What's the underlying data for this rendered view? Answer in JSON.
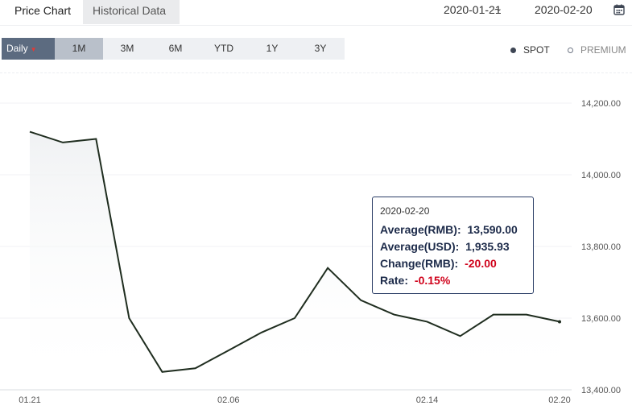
{
  "tabs": [
    {
      "label": "Price Chart"
    },
    {
      "label": "Historical Data"
    }
  ],
  "date_range": {
    "start": "2020-01-21",
    "separator": "~",
    "end": "2020-02-20"
  },
  "periods": [
    {
      "label": "Daily",
      "active": true
    },
    {
      "label": "1M",
      "selected": true
    },
    {
      "label": "3M"
    },
    {
      "label": "6M"
    },
    {
      "label": "YTD"
    },
    {
      "label": "1Y"
    },
    {
      "label": "3Y"
    }
  ],
  "modes": [
    {
      "label": "SPOT",
      "checked": true
    },
    {
      "label": "PREMIUM",
      "checked": false
    }
  ],
  "tooltip": {
    "date": "2020-02-20",
    "rows": [
      {
        "label": "Average(RMB):",
        "value": "13,590.00",
        "negative": false
      },
      {
        "label": "Average(USD):",
        "value": "1,935.93",
        "negative": false
      },
      {
        "label": "Change(RMB):",
        "value": "-20.00",
        "negative": true
      },
      {
        "label": "Rate:",
        "value": "-0.15%",
        "negative": true
      }
    ]
  },
  "colors": {
    "line": "#1f2d1f",
    "accent": "#5c6b80",
    "negative": "#d0021b"
  },
  "chart_data": {
    "type": "line",
    "x": [
      "01.21",
      "01.22",
      "01.23",
      "02.03",
      "02.04",
      "02.05",
      "02.06",
      "02.07",
      "02.10",
      "02.11",
      "02.12",
      "02.13",
      "02.14",
      "02.17",
      "02.18",
      "02.19",
      "02.20"
    ],
    "values": [
      14120,
      14090,
      14100,
      13600,
      13450,
      13460,
      13510,
      13560,
      13600,
      13740,
      13650,
      13610,
      13590,
      13550,
      13610,
      13610,
      13590
    ],
    "x_tick_labels": [
      "01.21",
      "02.06",
      "02.14",
      "02.20"
    ],
    "y_tick_labels": [
      "14,200.00",
      "14,000.00",
      "13,800.00",
      "13,600.00",
      "13,400.00"
    ],
    "ylim": [
      13400,
      14200
    ]
  }
}
